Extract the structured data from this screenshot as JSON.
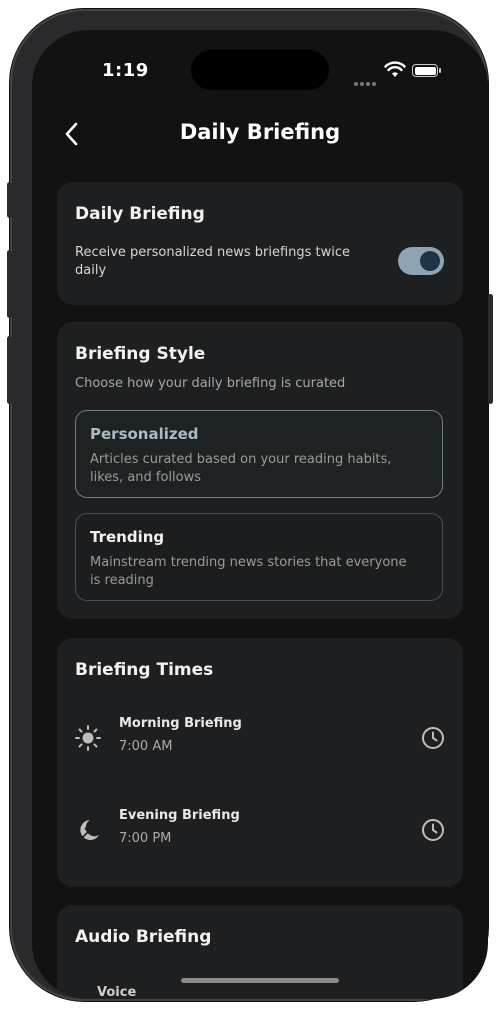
{
  "status_bar": {
    "time": "1:19"
  },
  "nav": {
    "title": "Daily Briefing"
  },
  "daily_briefing": {
    "title": "Daily Briefing",
    "description": "Receive personalized news briefings twice daily",
    "enabled": true
  },
  "briefing_style": {
    "title": "Briefing Style",
    "subtitle": "Choose how your daily briefing is curated",
    "options": [
      {
        "title": "Personalized",
        "description": "Articles curated based on your reading habits, likes, and follows",
        "selected": true
      },
      {
        "title": "Trending",
        "description": "Mainstream trending news stories that everyone is reading",
        "selected": false
      }
    ]
  },
  "briefing_times": {
    "title": "Briefing Times",
    "items": [
      {
        "label": "Morning Briefing",
        "time": "7:00 AM",
        "icon": "sun-icon"
      },
      {
        "label": "Evening Briefing",
        "time": "7:00 PM",
        "icon": "moon-icon"
      }
    ]
  },
  "audio_briefing": {
    "title": "Audio Briefing",
    "partial_label": "Voice"
  },
  "colors": {
    "background": "#121212",
    "card": "#1e1f20",
    "accent": "#8fa3b3",
    "selected_title": "#a9bcc6"
  }
}
